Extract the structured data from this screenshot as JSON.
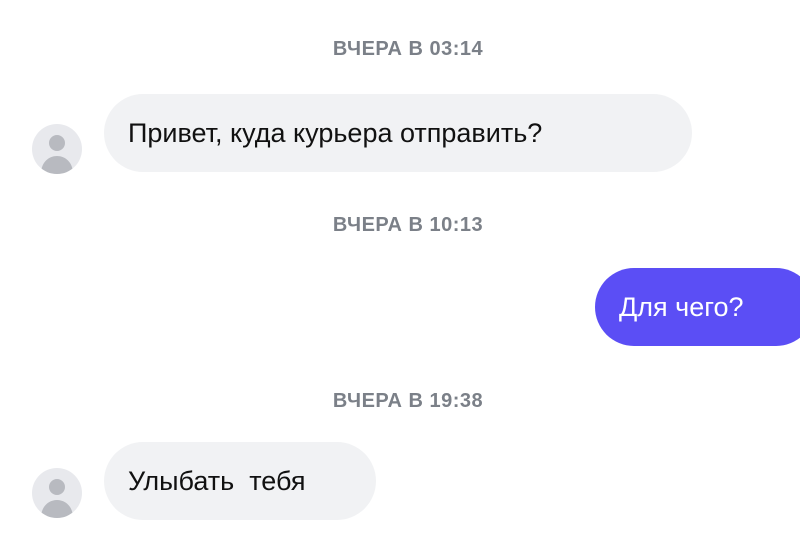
{
  "messages": [
    {
      "timestamp": "ВЧЕРА В 03:14",
      "direction": "incoming",
      "text": "Привет, куда курьера отправить?"
    },
    {
      "timestamp": "ВЧЕРА В 10:13",
      "direction": "outgoing",
      "text": "Для чего?"
    },
    {
      "timestamp": "ВЧЕРА В 19:38",
      "direction": "incoming",
      "text": "Улыбать  тебя"
    }
  ],
  "colors": {
    "incoming_bubble": "#f1f2f4",
    "outgoing_bubble": "#5b4ef5",
    "timestamp_text": "#7b8088",
    "avatar_bg": "#e8e9ed",
    "avatar_figure": "#b8bac0"
  },
  "icons": {
    "avatar": "person-placeholder-icon"
  }
}
